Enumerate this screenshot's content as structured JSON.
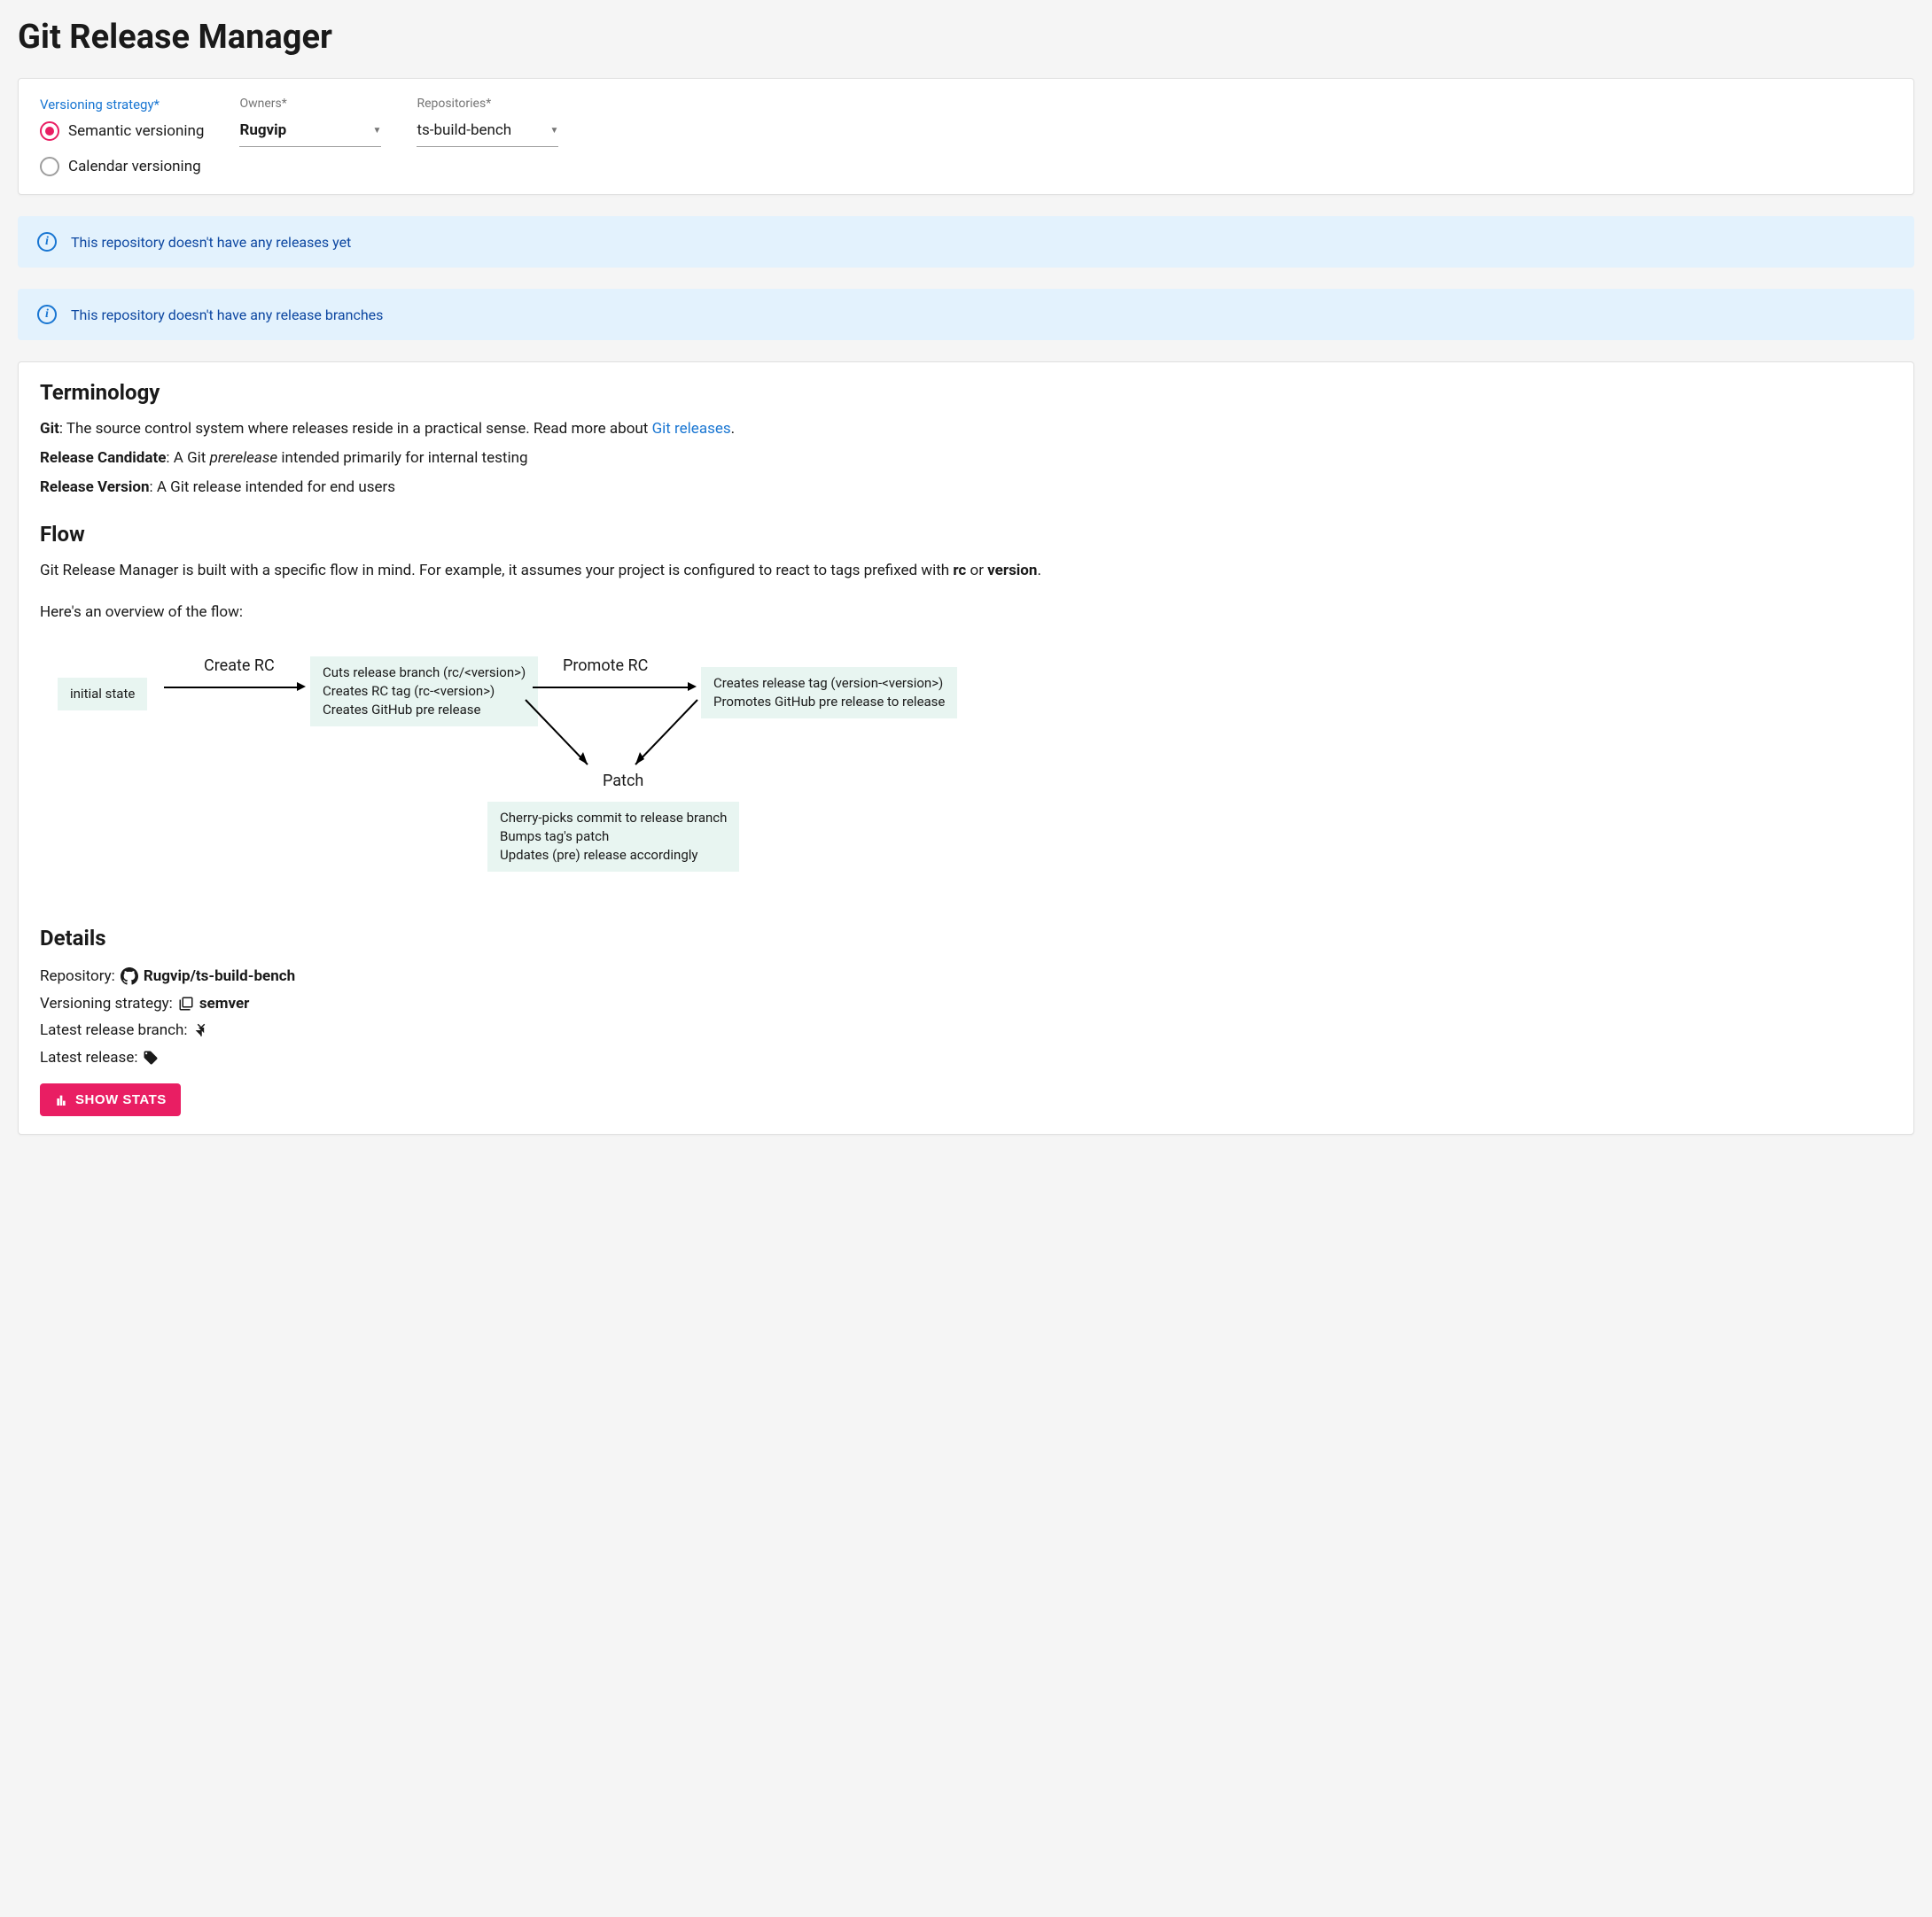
{
  "page_title": "Git Release Manager",
  "config": {
    "versioning_label": "Versioning strategy*",
    "versioning_options": {
      "semantic": "Semantic versioning",
      "calendar": "Calendar versioning"
    },
    "owners_label": "Owners*",
    "owners_value": "Rugvip",
    "repos_label": "Repositories*",
    "repos_value": "ts-build-bench"
  },
  "alerts": {
    "no_releases": "This repository doesn't have any releases yet",
    "no_branches": "This repository doesn't have any release branches"
  },
  "terminology": {
    "heading": "Terminology",
    "git_label": "Git",
    "git_text": ": The source control system where releases reside in a practical sense. Read more about ",
    "git_link": "Git releases",
    "rc_label": "Release Candidate",
    "rc_text_pre": ": A Git ",
    "rc_text_em": "prerelease",
    "rc_text_post": " intended primarily for internal testing",
    "rv_label": "Release Version",
    "rv_text": ": A Git release intended for end users"
  },
  "flow": {
    "heading": "Flow",
    "intro_pre": "Git Release Manager is built with a specific flow in mind. For example, it assumes your project is configured to react to tags prefixed with ",
    "intro_rc": "rc",
    "intro_or": " or ",
    "intro_version": "version",
    "intro_period": ".",
    "overview": "Here's an overview of the flow:",
    "initial": "initial state",
    "create_rc_label": "Create RC",
    "create_rc_line1": "Cuts release branch (rc/<version>)",
    "create_rc_line2": "Creates RC tag (rc-<version>)",
    "create_rc_line3": "Creates GitHub pre release",
    "promote_label": "Promote RC",
    "promote_line1": "Creates release tag (version-<version>)",
    "promote_line2": "Promotes GitHub pre release to release",
    "patch_label": "Patch",
    "patch_line1": "Cherry-picks commit to release branch",
    "patch_line2": "Bumps tag's patch",
    "patch_line3": "Updates (pre) release accordingly"
  },
  "details": {
    "heading": "Details",
    "repo_label": "Repository: ",
    "repo_value": "Rugvip/ts-build-bench",
    "versioning_label": "Versioning strategy: ",
    "versioning_value": "semver",
    "branch_label": "Latest release branch: ",
    "release_label": "Latest release: ",
    "button": "SHOW STATS"
  }
}
